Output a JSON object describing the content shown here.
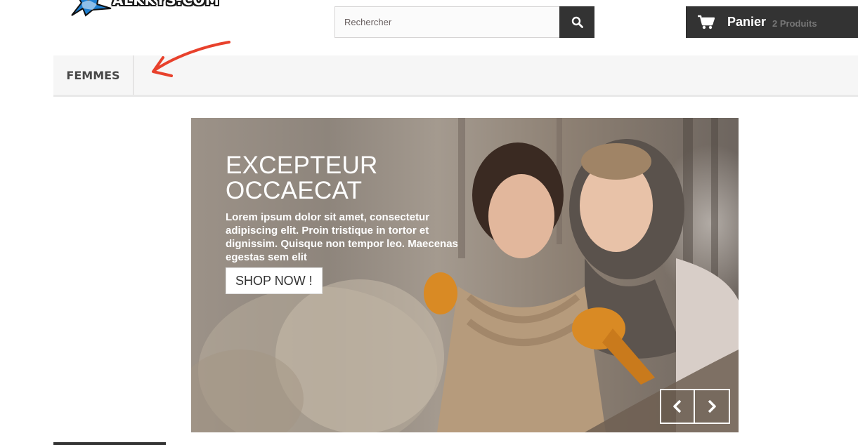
{
  "logo": {
    "text": "ALKKYS.COM"
  },
  "search": {
    "placeholder": "Rechercher"
  },
  "cart": {
    "label": "Panier",
    "count_text": "2 Produits"
  },
  "menu": {
    "items": [
      {
        "label": "FEMMES"
      }
    ]
  },
  "slider": {
    "title": "EXCEPTEUR OCCAECAT",
    "description": "Lorem ipsum dolor sit amet, consectetur adipiscing elit. Proin tristique in tortor et dignissim. Quisque non tempor leo. Maecenas egestas sem elit",
    "button_label": "SHOP NOW !"
  },
  "colors": {
    "dark": "#333333",
    "annotation_arrow": "#e8412c",
    "menu_bg": "#f6f6f6"
  }
}
